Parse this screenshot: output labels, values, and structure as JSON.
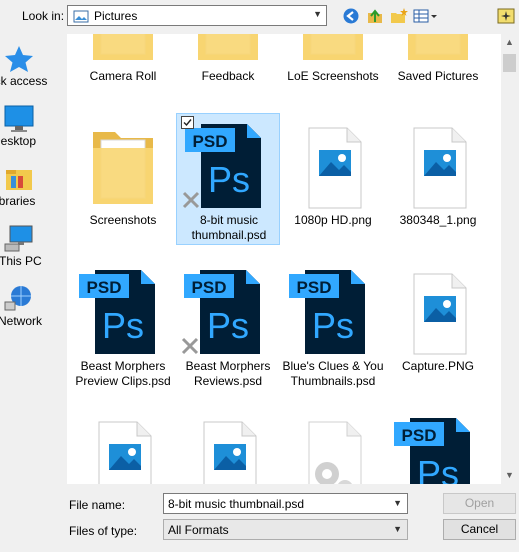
{
  "toolbar": {
    "lookin_label": "Look in:",
    "lookin_value": "Pictures",
    "icons": [
      "back-icon",
      "up-folder-icon",
      "new-folder-icon",
      "view-menu-icon",
      "extra-icon"
    ]
  },
  "places": [
    {
      "name": "quick-access",
      "label": "ick access",
      "icon": "star-icon"
    },
    {
      "name": "desktop",
      "label": "Desktop",
      "icon": "desktop-icon"
    },
    {
      "name": "libraries",
      "label": "ibraries",
      "icon": "libraries-icon"
    },
    {
      "name": "this-pc",
      "label": "This PC",
      "icon": "computer-icon"
    },
    {
      "name": "network",
      "label": "Network",
      "icon": "network-icon"
    }
  ],
  "files": {
    "row1": [
      {
        "label": "Camera Roll",
        "kind": "folder"
      },
      {
        "label": "Feedback",
        "kind": "folder"
      },
      {
        "label": "LoE Screenshots",
        "kind": "folder"
      },
      {
        "label": "Saved Pictures",
        "kind": "folder"
      }
    ],
    "row2": [
      {
        "label": "Screenshots",
        "kind": "folder"
      },
      {
        "label": "8-bit music thumbnail.psd",
        "kind": "psd",
        "selected": true
      },
      {
        "label": "1080p HD.png",
        "kind": "image"
      },
      {
        "label": "380348_1.png",
        "kind": "image"
      }
    ],
    "row3": [
      {
        "label": "Beast Morphers Preview Clips.psd",
        "kind": "psd"
      },
      {
        "label": "Beast Morphers Reviews.psd",
        "kind": "psd"
      },
      {
        "label": "Blue's Clues & You Thumbnails.psd",
        "kind": "psd"
      },
      {
        "label": "Capture.PNG",
        "kind": "image"
      }
    ]
  },
  "filename": {
    "label": "File name:",
    "value": "8-bit music thumbnail.psd"
  },
  "filetype": {
    "label": "Files of type:",
    "value": "All Formats"
  },
  "buttons": {
    "open": "Open",
    "cancel": "Cancel"
  },
  "colors": {
    "selection": "#cce8ff",
    "psd_dark": "#001e36",
    "psd_accent": "#31a8ff",
    "folder": "#f8d775"
  }
}
